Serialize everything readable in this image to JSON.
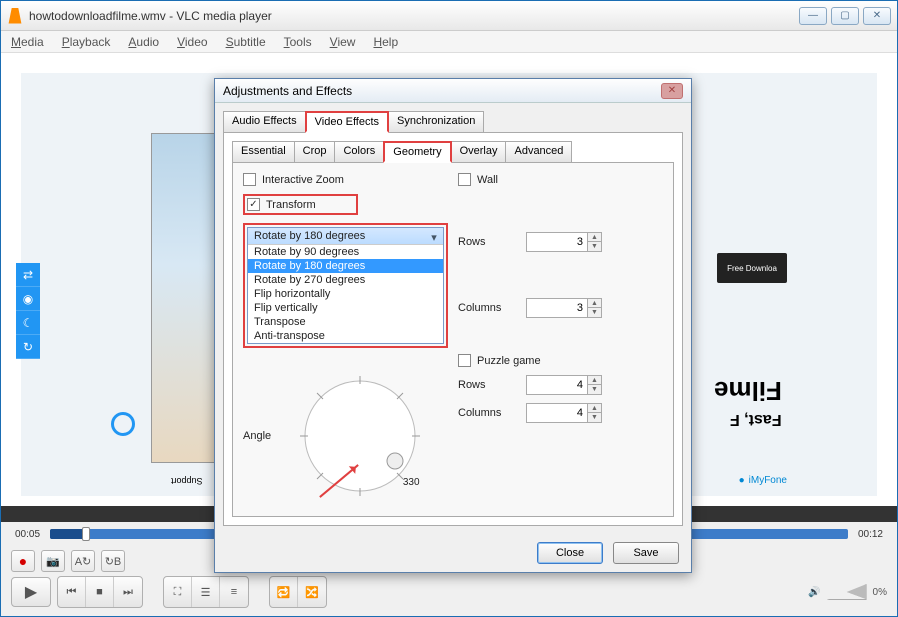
{
  "window_title": "howtodownloadfilme.wmv - VLC media player",
  "menu": {
    "media": "Media",
    "playback": "Playback",
    "audio": "Audio",
    "video": "Video",
    "subtitle": "Subtitle",
    "tools": "Tools",
    "view": "View",
    "help": "Help"
  },
  "seek": {
    "current": "00:05",
    "total": "00:12"
  },
  "volume": {
    "label": "0%"
  },
  "side_items": [
    "⇄",
    "◉",
    "☾",
    "↻"
  ],
  "video": {
    "support": "Support",
    "right_box": "Free Downloa",
    "big_text": "Filme",
    "fast": "Fast, F",
    "imyfone": "iMyFone"
  },
  "dialog": {
    "title": "Adjustments and Effects",
    "tabs1": [
      "Audio Effects",
      "Video Effects",
      "Synchronization"
    ],
    "active_tab1": 1,
    "tabs2": [
      "Essential",
      "Crop",
      "Colors",
      "Geometry",
      "Overlay",
      "Advanced"
    ],
    "active_tab2": 3,
    "interactive_zoom": "Interactive Zoom",
    "transform": "Transform",
    "angle": "Angle",
    "dial_tick": "330",
    "wall": {
      "label": "Wall",
      "rows_label": "Rows",
      "rows": "3",
      "cols_label": "Columns",
      "cols": "3"
    },
    "puzzle": {
      "label": "Puzzle game",
      "rows_label": "Rows",
      "rows": "4",
      "cols_label": "Columns",
      "cols": "4"
    },
    "dropdown": {
      "selected": "Rotate by 180 degrees",
      "options": [
        "Rotate by 90 degrees",
        "Rotate by 180 degrees",
        "Rotate by 270 degrees",
        "Flip horizontally",
        "Flip vertically",
        "Transpose",
        "Anti-transpose"
      ]
    },
    "close": "Close",
    "save": "Save"
  }
}
